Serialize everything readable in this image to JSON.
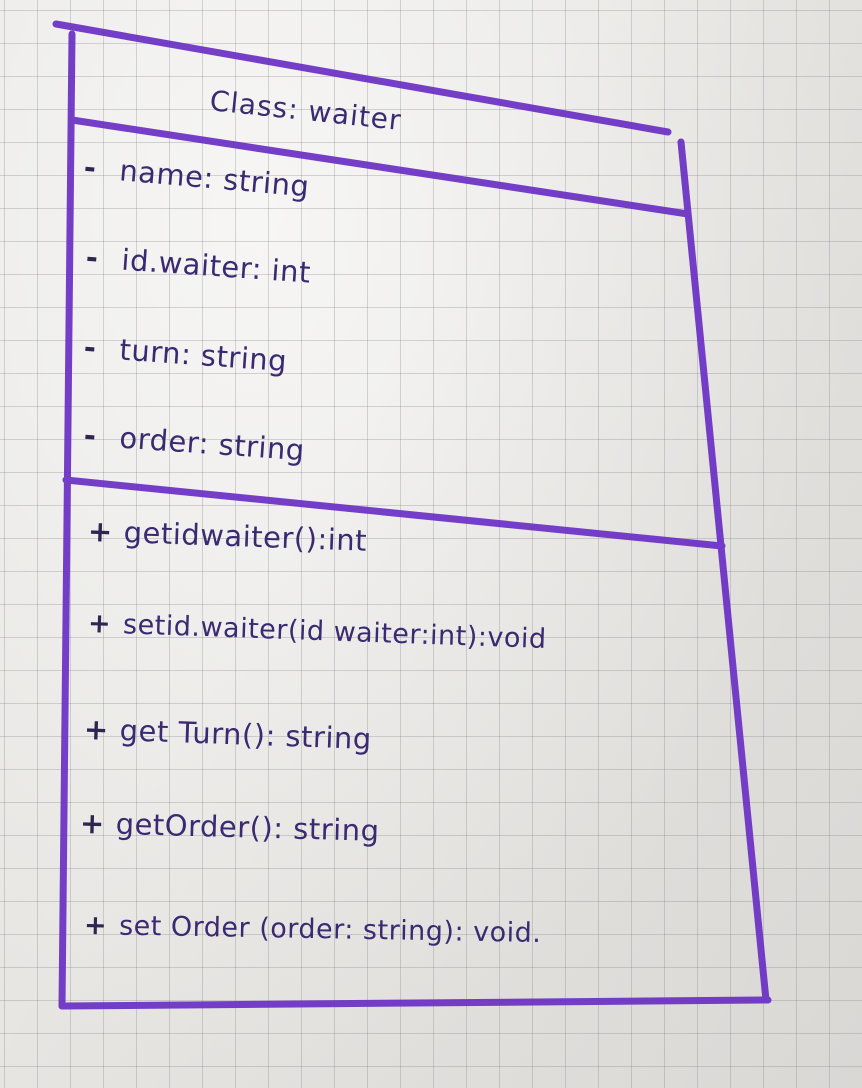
{
  "diagram": {
    "class_title": "Class: waiter",
    "attributes": [
      {
        "visibility": "-",
        "text": "name: string"
      },
      {
        "visibility": "-",
        "text": "id.waiter: int"
      },
      {
        "visibility": "-",
        "text": "turn: string"
      },
      {
        "visibility": "-",
        "text": "order: string"
      }
    ],
    "methods": [
      {
        "visibility": "+",
        "text": "getidwaiter():int"
      },
      {
        "visibility": "+",
        "text": "setid.waiter(id waiter:int):void"
      },
      {
        "visibility": "+",
        "text": "get Turn(): string"
      },
      {
        "visibility": "+",
        "text": "getOrder(): string"
      },
      {
        "visibility": "+",
        "text": "set Order (order: string): void."
      }
    ],
    "ink_color": "#6a2fc4",
    "paper_color": "#ecebe8"
  }
}
